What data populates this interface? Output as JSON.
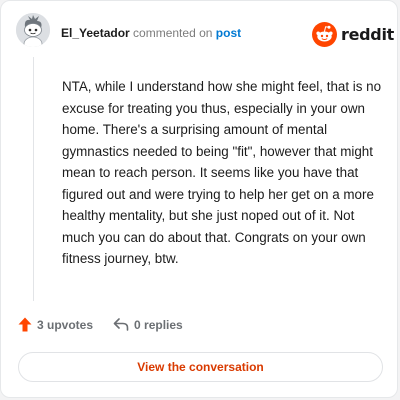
{
  "header": {
    "username": "El_Yeetador",
    "action_text": "commented on",
    "post_link": "post"
  },
  "logo": {
    "wordmark": "reddit",
    "icon": "reddit-snoo-icon",
    "color": "#ff4500"
  },
  "comment": {
    "text": "NTA, while I understand how she might feel, that is no excuse for treating you thus, especially in your own home. There's a surprising amount of mental gymnastics needed to being \"fit\", however that might mean to reach person. It seems like you have that figured out and were trying to help her get on a more healthy mentality, but she just noped out of it. Not much you can do about that. Congrats on your own fitness journey, btw."
  },
  "actions": {
    "upvotes": "3 upvotes",
    "replies": "0 replies",
    "upvote_icon": "upvote-arrow-icon",
    "reply_icon": "reply-arrow-icon"
  },
  "button": {
    "label": "View the conversation"
  },
  "colors": {
    "accent": "#d93a00",
    "link": "#0079d3",
    "upvote": "#ff4500"
  }
}
